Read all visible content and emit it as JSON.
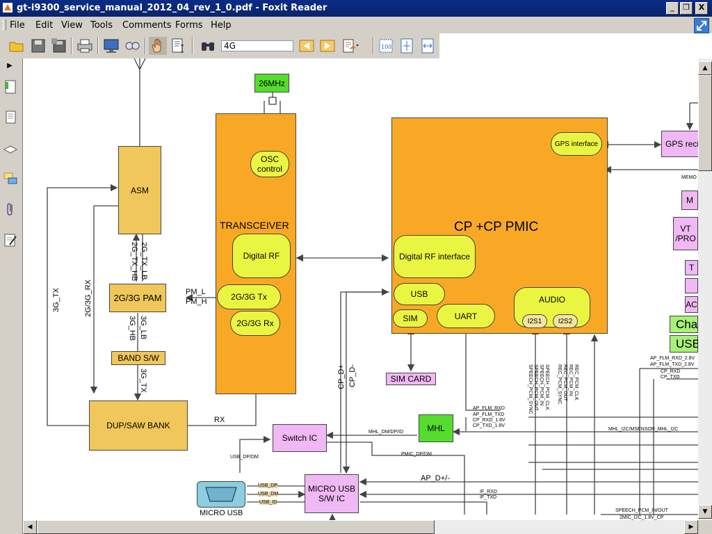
{
  "window": {
    "title": "gt-i9300_service_manual_2012_04_rev_1_0.pdf - Foxit Reader",
    "minimize": "_",
    "restore": "❐",
    "close": "X"
  },
  "menu": [
    "File",
    "Edit",
    "View",
    "Tools",
    "Comments",
    "Forms",
    "Help"
  ],
  "toolbar": {
    "icons": [
      "open-icon",
      "save-icon",
      "save-as-icon",
      "print-icon",
      "full-screen-icon",
      "zoom-icon",
      "hand-tool-icon",
      "text-select-icon",
      "find-icon"
    ],
    "search_value": "4G",
    "right_icons": [
      "previous-result-icon",
      "next-result-icon",
      "search-options-icon",
      "actual-size-icon",
      "fit-page-icon",
      "fit-width-icon"
    ]
  },
  "left_panel_icons": [
    "bookmarks-icon",
    "pages-icon",
    "layers-icon",
    "comments-icon",
    "attachments-icon",
    "signatures-icon"
  ],
  "diagram": {
    "osc_26": "26MHz",
    "osc_control": "OSC control",
    "transceiver": "TRANSCEIVER",
    "digital_rf": "Digital RF",
    "tx": "2G/3G Tx",
    "rx_block": "2G/3G Rx",
    "asm": "ASM",
    "pam": "2G/3G PAM",
    "band_sw": "BAND S/W",
    "dup_saw": "DUP/SAW BANK",
    "cp_pmic": "CP +CP PMIC",
    "gps_interface": "GPS interface",
    "gps_receiver": "GPS reci",
    "digital_rf_interface": "Digital RF interface",
    "usb": "USB",
    "sim": "SIM",
    "uart": "UART",
    "audio": "AUDIO",
    "i2s1": "I2S1",
    "i2s2": "I2S2",
    "sim_card": "SIM CARD",
    "switch_ic": "Switch IC",
    "mhl": "MHL",
    "micro_usb_sw": "MICRO USB S/W IC",
    "micro_usb": "MICRO USB",
    "right_m": "M",
    "right_vt": "VT /PRO",
    "right_t": "T",
    "right_ac": "AC",
    "chg": "Cha",
    "usb_right": "USB",
    "labels": {
      "pm_l": "PM_L",
      "pm_h": "PM_H",
      "rx": "RX",
      "g3_tx": "3G_TX",
      "g23_rx": "2G/3G_RX",
      "tx_lb": "2G_TX_LB",
      "tx_hb": "2G_TX_HB",
      "g3_lb": "3G_LB",
      "g3_hb": "3G_HB",
      "g3_tx2": "3G_TX",
      "cp_dp": "CP_D+",
      "cp_dm": "CP_D-",
      "usb_dpdm": "USB_DP/DM",
      "usb_dp": "USB_DP",
      "usb_dm": "USB_DM",
      "usb_id": "USB_ID",
      "mhl_dm": "MHL_DM/DP/ID",
      "pmic_dpdm": "PMIC_DP/DM",
      "ap_flm_rxd": "AP_FLM_RXD",
      "ap_flm_txd": "AP_FLM_TXD",
      "cp_rxd18": "CP_RXD_1.8V",
      "cp_txd18": "CP_TXD_1.8V",
      "ap_dpm": "AP_D+/-",
      "if_rxd": "IF_RXD",
      "if_txd": "IF_TXD",
      "mhl_i2c": "MHL_I2C/MSENSOR_MHL_I2C",
      "memo": "MEMO",
      "ap_flm_rxd28": "AP_FLM_RXD_2.8V",
      "ap_flm_txd28": "AP_FLM_TXD_2.8V",
      "cp_rxd": "CP_RXD",
      "cp_txd": "CP_TXD",
      "speech_pcm": "SPEECH_PCM_IN/OUT",
      "mic_i2c": "2MIC_I2C_1.8V_CP",
      "sp_clk": "SPEECH_PCM_CLK",
      "sp_in": "SPEECH_PCM_IN",
      "sp_out": "SPEECH_PCM_OUT",
      "sp_sync": "SPEECH_PCM_SYNC",
      "rec_clk": "REC_PCM_CLK",
      "rec_in": "REC_PCM_IN",
      "rec_out": "REC_PCM_OUT",
      "rec_sync": "REC_PCM_SYNC"
    }
  }
}
